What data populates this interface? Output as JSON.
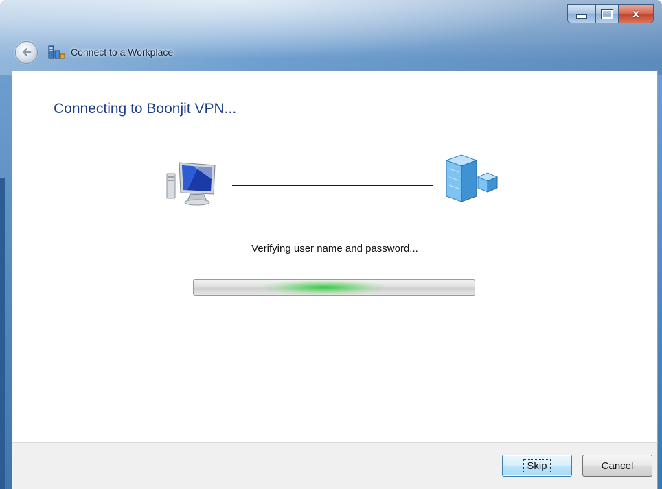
{
  "window": {
    "title": "Connect to a Workplace",
    "controls": {
      "minimize_icon": "minimize-icon",
      "maximize_icon": "maximize-icon",
      "close_icon": "close-icon",
      "close_glyph": "x"
    }
  },
  "main": {
    "heading": "Connecting to Boonjit VPN...",
    "status_text": "Verifying user name and password...",
    "connection": {
      "local_icon": "computer-icon",
      "remote_icon": "server-icon"
    },
    "progress": {
      "mode": "indeterminate"
    }
  },
  "footer": {
    "skip_label": "Skip",
    "cancel_label": "Cancel"
  },
  "colors": {
    "heading": "#1e3f8a",
    "progress_glow": "#30c840",
    "titlebar": "#3e76ad",
    "close_button": "#c0432a"
  }
}
